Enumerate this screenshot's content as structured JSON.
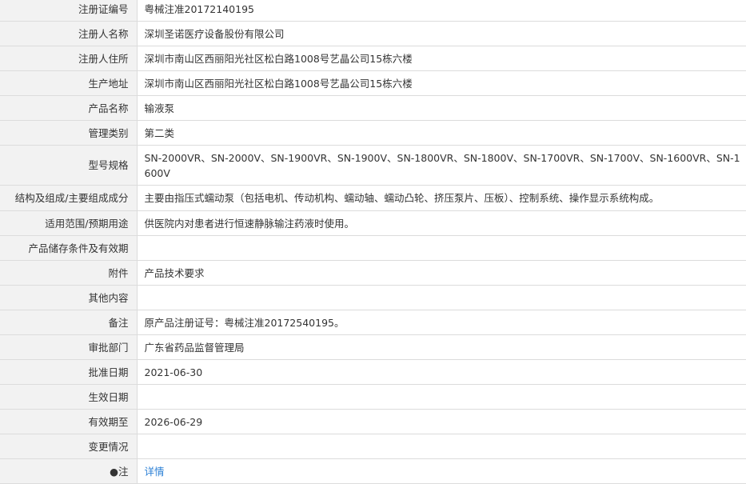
{
  "rows": [
    {
      "label": "注册证编号",
      "value": "粤械注准20172140195"
    },
    {
      "label": "注册人名称",
      "value": "深圳圣诺医疗设备股份有限公司"
    },
    {
      "label": "注册人住所",
      "value": "深圳市南山区西丽阳光社区松白路1008号艺晶公司15栋六楼"
    },
    {
      "label": "生产地址",
      "value": "深圳市南山区西丽阳光社区松白路1008号艺晶公司15栋六楼"
    },
    {
      "label": "产品名称",
      "value": "输液泵"
    },
    {
      "label": "管理类别",
      "value": "第二类"
    },
    {
      "label": "型号规格",
      "value": "SN-2000VR、SN-2000V、SN-1900VR、SN-1900V、SN-1800VR、SN-1800V、SN-1700VR、SN-1700V、SN-1600VR、SN-1600V"
    },
    {
      "label": "结构及组成/主要组成成分",
      "value": "主要由指压式蠕动泵（包括电机、传动机构、蠕动轴、蠕动凸轮、挤压泵片、压板）、控制系统、操作显示系统构成。"
    },
    {
      "label": "适用范围/预期用途",
      "value": "供医院内对患者进行恒速静脉输注药液时使用。"
    },
    {
      "label": "产品储存条件及有效期",
      "value": ""
    },
    {
      "label": "附件",
      "value": "产品技术要求"
    },
    {
      "label": "其他内容",
      "value": ""
    },
    {
      "label": "备注",
      "value": "原产品注册证号：粤械注准20172540195。"
    },
    {
      "label": "审批部门",
      "value": "广东省药品监督管理局"
    },
    {
      "label": "批准日期",
      "value": "2021-06-30"
    },
    {
      "label": "生效日期",
      "value": ""
    },
    {
      "label": "有效期至",
      "value": "2026-06-29"
    },
    {
      "label": "变更情况",
      "value": ""
    }
  ],
  "last_row": {
    "label": "●注",
    "link_text": "详情"
  }
}
